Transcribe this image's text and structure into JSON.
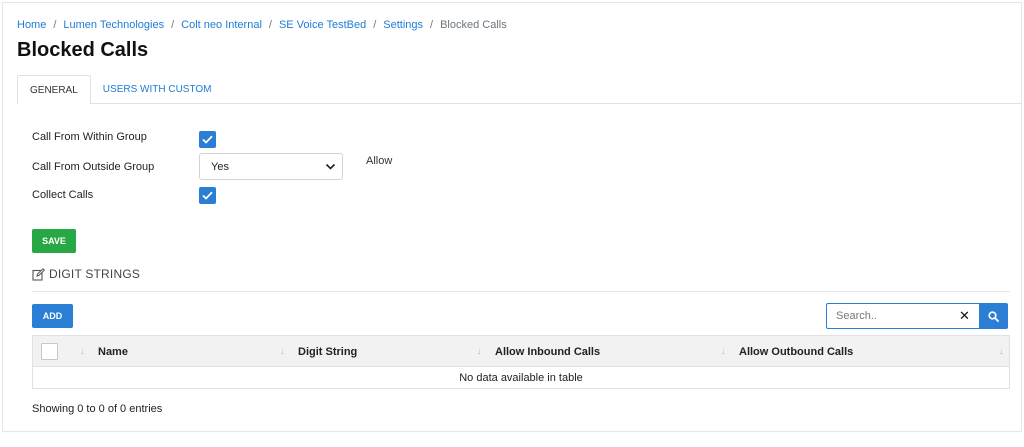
{
  "breadcrumb": {
    "items": [
      "Home",
      "Lumen Technologies",
      "Colt neo Internal",
      "SE Voice TestBed",
      "Settings"
    ],
    "current": "Blocked Calls",
    "separator": "/"
  },
  "page_title": "Blocked Calls",
  "tabs": [
    {
      "label": "GENERAL",
      "active": true
    },
    {
      "label": "USERS WITH CUSTOM",
      "active": false
    }
  ],
  "form": {
    "call_within_group": {
      "label": "Call From Within Group",
      "checked": true
    },
    "call_outside_group": {
      "label": "Call From Outside Group",
      "value": "Yes",
      "hint": "Allow"
    },
    "collect_calls": {
      "label": "Collect Calls",
      "checked": true
    },
    "save_label": "SAVE"
  },
  "digit_strings": {
    "title": "DIGIT STRINGS",
    "add_label": "ADD",
    "search_placeholder": "Search..",
    "columns": [
      "Name",
      "Digit String",
      "Allow Inbound Calls",
      "Allow Outbound Calls"
    ],
    "sort_glyph": "↓",
    "empty_message": "No data available in table",
    "info": "Showing 0 to 0 of 0 entries"
  },
  "colors": {
    "primary": "#2a7fd4",
    "success": "#28a745",
    "link": "#1f7bd6"
  }
}
